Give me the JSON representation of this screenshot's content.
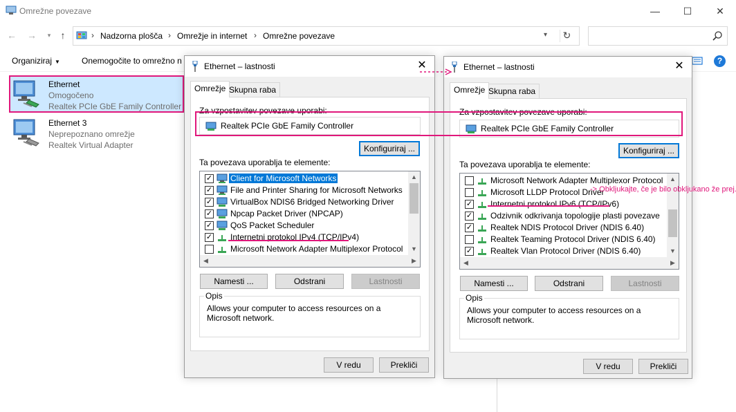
{
  "window": {
    "title": "Omrežne povezave",
    "controls": {
      "minimize": "—",
      "maximize": "☐",
      "close": "✕"
    }
  },
  "address": {
    "crumbs": [
      "Nadzorna plošča",
      "Omrežje in internet",
      "Omrežne povezave"
    ],
    "separator": "›",
    "search_placeholder": ""
  },
  "commands": {
    "organize": "Organiziraj",
    "disable": "Onemogočite to omrežno n"
  },
  "adapters": [
    {
      "name": "Ethernet",
      "status": "Omogočeno",
      "device": "Realtek PCIe GbE Family Controller",
      "selected": true
    },
    {
      "name": "Ethernet 3",
      "status": "Neprepoznano omrežje",
      "device": "Realtek Virtual Adapter",
      "selected": false
    }
  ],
  "dialog_ipv4": {
    "title": "Ethernet – lastnosti",
    "tabs": [
      "Omrežje",
      "Skupna raba"
    ],
    "connect_using_label": "Za vzpostavitev povezave uporabi:",
    "device": "Realtek PCIe GbE Family Controller",
    "configure": "Konfiguriraj ...",
    "items_label": "Ta povezava uporablja te elemente:",
    "items": [
      {
        "label": "Client for Microsoft Networks",
        "checked": true,
        "selected": true,
        "icon": "network-client-icon"
      },
      {
        "label": "File and Printer Sharing for Microsoft Networks",
        "checked": true,
        "selected": false,
        "icon": "sharing-icon"
      },
      {
        "label": "VirtualBox NDIS6 Bridged Networking Driver",
        "checked": true,
        "selected": false,
        "icon": "driver-icon"
      },
      {
        "label": "Npcap Packet Driver (NPCAP)",
        "checked": true,
        "selected": false,
        "icon": "driver-icon"
      },
      {
        "label": "QoS Packet Scheduler",
        "checked": true,
        "selected": false,
        "icon": "scheduler-icon"
      },
      {
        "label": "Internetni protokol IPv4 (TCP/IPv4)",
        "checked": true,
        "selected": false,
        "icon": "protocol-icon"
      },
      {
        "label": "Microsoft Network Adapter Multiplexor Protocol",
        "checked": false,
        "selected": false,
        "icon": "protocol-icon"
      }
    ],
    "install": "Namesti ...",
    "uninstall": "Odstrani",
    "properties": "Lastnosti",
    "description_title": "Opis",
    "description": "Allows your computer to access resources on a Microsoft network.",
    "ok": "V redu",
    "cancel": "Prekliči"
  },
  "dialog_ipv6": {
    "title": "Ethernet – lastnosti",
    "tabs": [
      "Omrežje",
      "Skupna raba"
    ],
    "connect_using_label": "Za vzpostavitev povezave uporabi:",
    "device": "Realtek PCIe GbE Family Controller",
    "configure": "Konfiguriraj ...",
    "items_label": "Ta povezava uporablja te elemente:",
    "items": [
      {
        "label": "Microsoft Network Adapter Multiplexor Protocol",
        "checked": false,
        "selected": false,
        "icon": "protocol-icon"
      },
      {
        "label": "Microsoft LLDP Protocol Driver",
        "checked": false,
        "selected": false,
        "icon": "protocol-icon"
      },
      {
        "label": "Internetni protokol IPv6 (TCP/IPv6)",
        "checked": true,
        "selected": false,
        "icon": "protocol-icon"
      },
      {
        "label": "Odzivnik odkrivanja topologije plasti povezave",
        "checked": true,
        "selected": false,
        "icon": "protocol-icon"
      },
      {
        "label": "Realtek NDIS Protocol Driver (NDIS 6.40)",
        "checked": true,
        "selected": false,
        "icon": "protocol-icon"
      },
      {
        "label": "Realtek Teaming Protocol Driver (NDIS 6.40)",
        "checked": false,
        "selected": false,
        "icon": "protocol-icon"
      },
      {
        "label": "Realtek Vlan Protocol Driver (NDIS 6.40)",
        "checked": true,
        "selected": false,
        "icon": "protocol-icon"
      }
    ],
    "install": "Namesti ...",
    "uninstall": "Odstrani",
    "properties": "Lastnosti",
    "description_title": "Opis",
    "description": "Allows your computer to access resources on a Microsoft network.",
    "ok": "V redu",
    "cancel": "Prekliči"
  },
  "annotation": {
    "text": "-> Obkljukajte, če je bilo obkljukano že prej.",
    "color": "#e0177b"
  },
  "colors": {
    "accent": "#0078d7",
    "highlight": "#e0177b",
    "selection": "#cde8ff"
  }
}
